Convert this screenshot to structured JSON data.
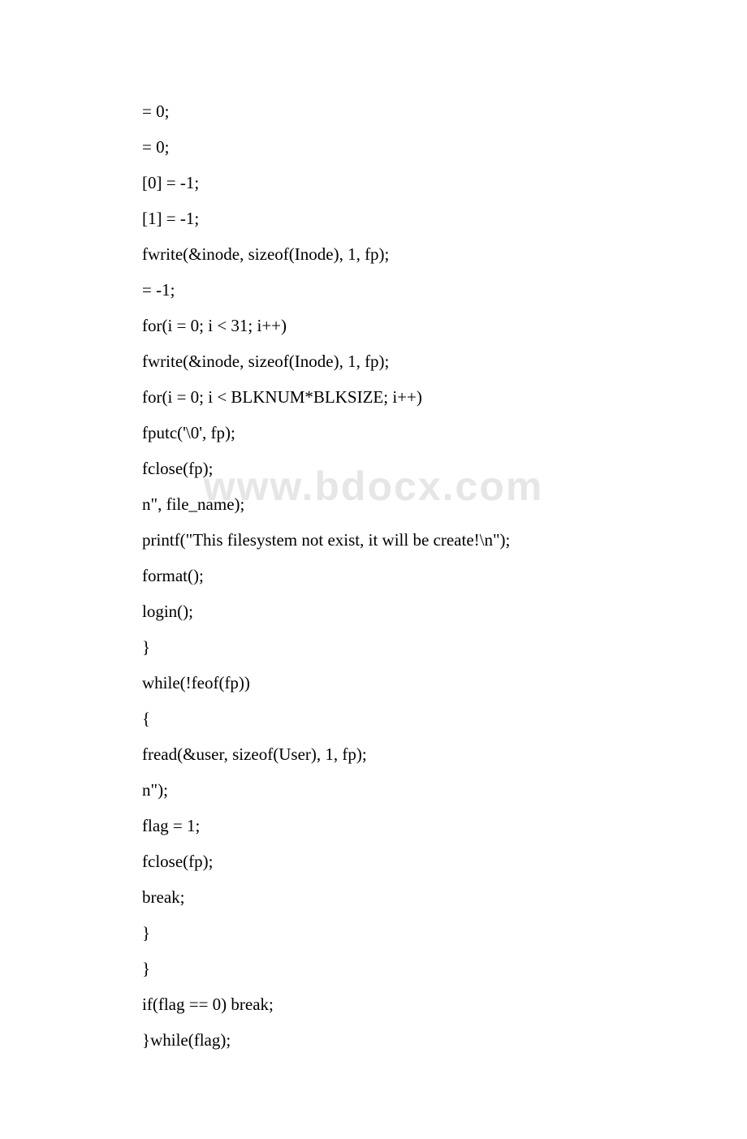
{
  "watermark": "www.bdocx.com",
  "lines": [
    "= 0;",
    "= 0;",
    "[0] = -1;",
    "[1] = -1;",
    "fwrite(&inode, sizeof(Inode), 1, fp);",
    "= -1;",
    "for(i = 0; i < 31; i++)",
    "fwrite(&inode, sizeof(Inode), 1, fp);",
    "for(i = 0; i < BLKNUM*BLKSIZE; i++)",
    "fputc('\\0', fp);",
    "fclose(fp);",
    "n\", file_name);",
    "printf(\"This filesystem not exist, it will be create!\\n\");",
    "format();",
    "login();",
    "}",
    "while(!feof(fp))",
    "{",
    "fread(&user, sizeof(User), 1, fp);",
    "n\");",
    "flag = 1;",
    "fclose(fp);",
    "break;",
    "}",
    "}",
    "if(flag == 0) break;",
    "}while(flag);"
  ]
}
